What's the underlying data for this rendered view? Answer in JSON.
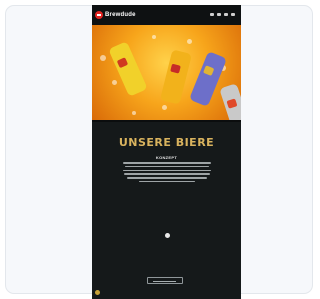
{
  "header": {
    "brand": "Brewdude",
    "nav_icons": [
      "search-icon",
      "user-icon",
      "cart-icon",
      "menu-icon"
    ]
  },
  "hero": {
    "image": "beer-cans-hero",
    "cans": [
      {
        "color": "#f1d12a",
        "label_color": "#d03a20"
      },
      {
        "color": "#f2b21b",
        "label_color": "#c62b28"
      },
      {
        "color": "#6d6fc9",
        "label_color": "#e0b435"
      },
      {
        "color": "#c9c9c9",
        "label_color": "#e04a2a"
      }
    ]
  },
  "section": {
    "title": "UNSERE BIERE",
    "subtitle": "KONZEPT"
  },
  "colors": {
    "accent": "#d9b35e",
    "background": "#15191a",
    "brand_red": "#e22421"
  }
}
